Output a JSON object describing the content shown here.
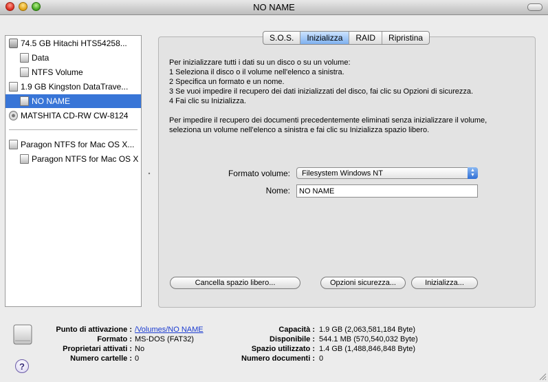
{
  "window": {
    "title": "NO NAME"
  },
  "sidebar": {
    "items": [
      {
        "label": "74.5 GB Hitachi HTS54258...",
        "icon": "hard-disk-icon"
      },
      {
        "label": "Data",
        "icon": "volume-icon"
      },
      {
        "label": "NTFS Volume",
        "icon": "volume-icon"
      },
      {
        "label": "1.9 GB Kingston DataTrave...",
        "icon": "usb-disk-icon"
      },
      {
        "label": "NO NAME",
        "icon": "volume-icon",
        "selected": true
      },
      {
        "label": "MATSHITA CD-RW CW-8124",
        "icon": "cd-drive-icon"
      },
      {
        "label": "Paragon NTFS for Mac OS X...",
        "icon": "disk-image-icon"
      },
      {
        "label": "Paragon NTFS for Mac OS X",
        "icon": "mounted-image-icon"
      }
    ]
  },
  "tabs": [
    {
      "label": "S.O.S."
    },
    {
      "label": "Inizializza",
      "active": true
    },
    {
      "label": "RAID"
    },
    {
      "label": "Ripristina"
    }
  ],
  "instructions": {
    "lines": [
      "Per inizializzare tutti i dati su un disco o su un volume:",
      "1 Seleziona il disco o il volume nell'elenco a sinistra.",
      "2 Specifica un formato e un nome.",
      "3 Se vuoi impedire il recupero dei dati inizializzati del disco, fai clic su Opzioni di sicurezza.",
      "4 Fai clic su Inizializza."
    ],
    "free_space_lines": [
      "Per impedire il recupero dei documenti precedentemente eliminati senza inizializzare il volume,",
      "seleziona un volume nell'elenco a sinistra e fai clic su Inizializza spazio libero."
    ]
  },
  "form": {
    "format_label": "Formato volume:",
    "format_value": "Filesystem Windows NT",
    "name_label": "Nome:",
    "name_value": "NO NAME"
  },
  "buttons": {
    "erase_free_space": "Cancella spazio libero...",
    "security_options": "Opzioni sicurezza...",
    "erase": "Inizializza..."
  },
  "info": {
    "mount_point_label": "Punto di attivazione :",
    "mount_point_value": "/Volumes/NO NAME",
    "format_label": "Formato :",
    "format_value": "MS-DOS (FAT32)",
    "owners_label": "Proprietari attivati :",
    "owners_value": "No",
    "folders_label": "Numero cartelle :",
    "folders_value": "0",
    "capacity_label": "Capacità :",
    "capacity_value": "1.9 GB (2,063,581,184 Byte)",
    "available_label": "Disponibile :",
    "available_value": "544.1 MB (570,540,032 Byte)",
    "used_label": "Spazio utilizzato :",
    "used_value": "1.4 GB (1,488,846,848 Byte)",
    "documents_label": "Numero documenti :",
    "documents_value": "0"
  },
  "colors": {
    "selection": "#3875d7",
    "link": "#1a3bd1"
  }
}
